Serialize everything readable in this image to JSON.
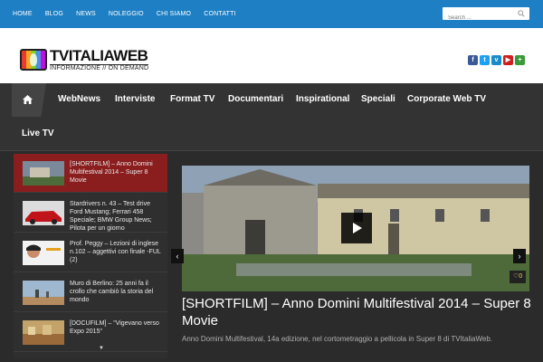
{
  "topnav": {
    "items": [
      "HOME",
      "BLOG",
      "NEWS",
      "NOLEGGIO",
      "CHI SIAMO",
      "CONTATTI"
    ]
  },
  "search": {
    "placeholder": "Search ..."
  },
  "logo": {
    "main": "TVITALIAWEB",
    "sub": "INFORMAZIONE // ON DEMAND"
  },
  "social": [
    {
      "icon": "facebook-icon",
      "glyph": "f",
      "color": "#3b5998"
    },
    {
      "icon": "twitter-icon",
      "glyph": "t",
      "color": "#1da1f2"
    },
    {
      "icon": "vimeo-icon",
      "glyph": "v",
      "color": "#1a8dc8"
    },
    {
      "icon": "youtube-icon",
      "glyph": "▶",
      "color": "#cc1f1f"
    },
    {
      "icon": "plus-icon",
      "glyph": "+",
      "color": "#3a9a3a"
    }
  ],
  "mainnav": {
    "items": [
      "WebNews",
      "Interviste",
      "Format TV",
      "Documentari",
      "Inspirational",
      "Speciali",
      "Corporate Web TV",
      "Live TV"
    ]
  },
  "sidebar": {
    "items": [
      "[SHORTFILM] – Anno Domini Multifestival 2014 – Super 8 Movie",
      "Stardrivers n. 43 – Test drive Ford Mustang; Ferrari 458 Speciale; BMW Group News; Pilota per un giorno",
      "Prof. Peggy – Lezioni di inglese n.102 – aggettivi con finale -FUL (2)",
      "Muro di Berlino: 25 anni fa il crollo che cambiò la storia del mondo",
      "[DOCUFILM] – \"Vigevano verso Expo 2015\""
    ]
  },
  "slider": {
    "comments": "0",
    "title": "[SHORTFILM] – Anno Domini Multifestival 2014 – Super 8 Movie",
    "excerpt": "Anno Domini Multifestival, 14a edizione, nel cortometraggio a pellicola in Super 8 di TVItaliaWeb."
  }
}
